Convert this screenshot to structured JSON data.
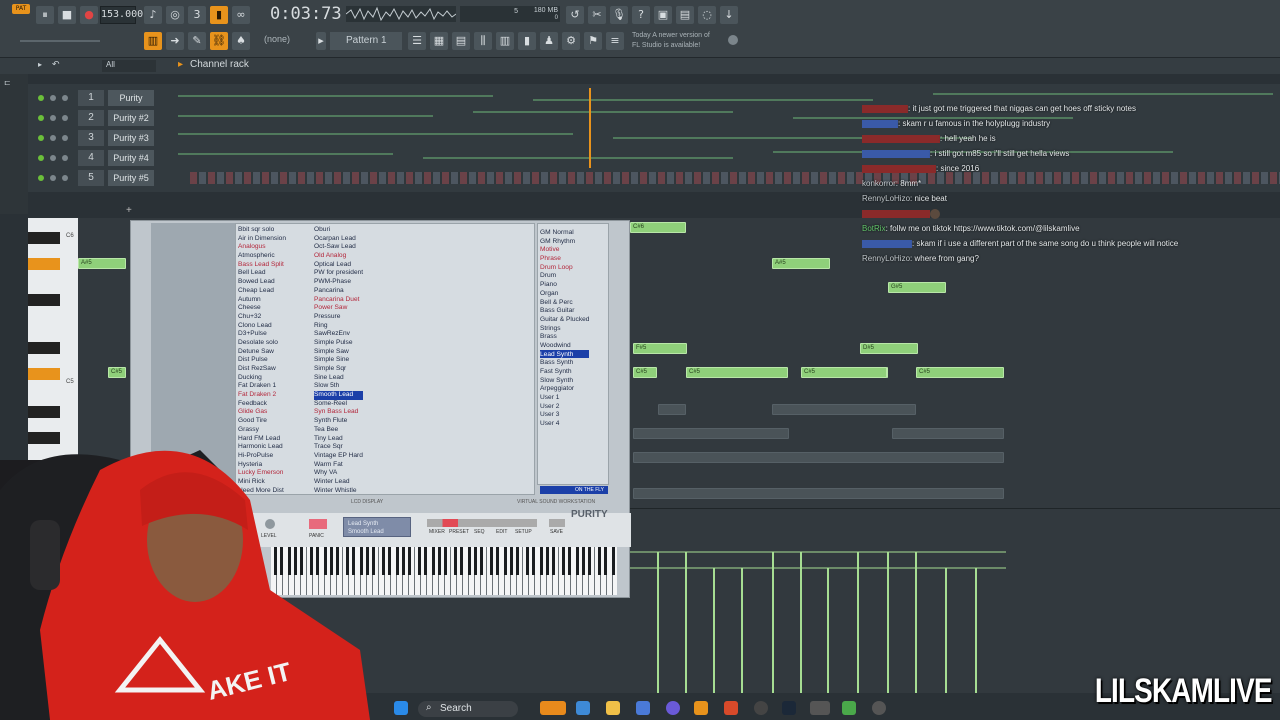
{
  "toolbar": {
    "tempo": "153.000",
    "time": "0:03:73",
    "cpu_value": "5",
    "memory": "180 MB",
    "memory_sub": "0",
    "pattern_label": "Pattern 1",
    "snap": "(none)",
    "news_line1": "Today  A newer version of",
    "news_line2": "FL Studio is available!"
  },
  "channel_rack": {
    "title": "Channel rack",
    "filter": "All",
    "channels": [
      {
        "num": "1",
        "name": "Purity"
      },
      {
        "num": "2",
        "name": "Purity #2"
      },
      {
        "num": "3",
        "name": "Purity #3"
      },
      {
        "num": "4",
        "name": "Purity #4"
      },
      {
        "num": "5",
        "name": "Purity #5"
      }
    ]
  },
  "piano_roll": {
    "key_labels": [
      "C6",
      "C5"
    ],
    "notes": [
      {
        "label": "C#6"
      },
      {
        "label": "A#5"
      },
      {
        "label": "A#5"
      },
      {
        "label": "G#5"
      },
      {
        "label": "F#5"
      },
      {
        "label": "D#5"
      },
      {
        "label": "C#5"
      },
      {
        "label": "C#5"
      },
      {
        "label": "C#5"
      },
      {
        "label": "C#5"
      },
      {
        "label": "A#5"
      },
      {
        "label": "C#5"
      }
    ]
  },
  "plugin": {
    "preset_list_a": [
      "Bbit sqr solo",
      "Air in Dimension",
      "Analogus",
      "Atmospheric",
      "Bass Lead Split",
      "Bell Lead",
      "Bowed Lead",
      "Cheap Lead",
      "Autumn",
      "Cheese",
      "Chu+32",
      "Clono Lead",
      "D3+Pulse",
      "Desolate solo",
      "Detune Saw",
      "Dist Pulse",
      "Dist RezSaw",
      "Ducking",
      "Fat Draken 1",
      "Fat Draken 2",
      "Feedback",
      "Glide Gas",
      "Good Tire",
      "Grassy",
      "Hard FM Lead",
      "Harmonic Lead",
      "Hi-ProPulse",
      "Hysteria",
      "Lucky Emerson",
      "Mini Rick",
      "Need More Dist"
    ],
    "preset_list_b": [
      "Oburi",
      "Ocarpan Lead",
      "Oct-Saw Lead",
      "Old Analog",
      "Optical Lead",
      "PW for president",
      "PWM-Phase",
      "Pancarina",
      "Pancarina Duet",
      "Power Saw",
      "Pressure",
      "Ring",
      "SawRezEnv",
      "Simple Pulse",
      "Simple Saw",
      "Simple Sine",
      "Simple Sqr",
      "Sine Lead",
      "Slow 5th",
      "Smooth Lead",
      "Some-Reel",
      "Syn Bass Lead",
      "Synth Flute",
      "Tea Bee",
      "Tiny Lead",
      "Trace Sqr",
      "Vintage EP Hard",
      "Warm Fat",
      "Why VA",
      "Winter Lead",
      "Winter Whistle"
    ],
    "selected_preset": "Smooth Lead",
    "categories": [
      "GM Normal",
      "GM Rhythm",
      "Motive",
      "Phrase",
      "Drum Loop",
      "Drum",
      "Piano",
      "Organ",
      "Bell & Perc",
      "Bass Guitar",
      "Guitar & Plucked",
      "Strings",
      "Brass",
      "Woodwind",
      "Lead Synth",
      "Bass Synth",
      "Fast Synth",
      "Slow Synth",
      "Arpeggiator",
      "User 1",
      "User 2",
      "User 3",
      "User 4"
    ],
    "selected_category": "Lead Synth",
    "brand": "PURITY",
    "lcd_label": "LCD DISPLAY",
    "vendor": "VIRTUAL  SOUND  WORKSTATION",
    "on_the_fly": "ON THE FLY",
    "display_line1": "Lead Synth",
    "display_line2": "Smooth Lead",
    "knob_labels": [
      "LEVEL",
      "PANIC"
    ],
    "buttons": [
      "MIXER",
      "PRESET",
      "SEQ",
      "EDIT",
      "SETUP",
      "SAVE"
    ]
  },
  "chat": [
    {
      "user": "",
      "text": ": it just got me triggered that niggas can get hoes off sticky notes"
    },
    {
      "user": "",
      "text": ": skam r u famous in the holyplugg industry"
    },
    {
      "user": "",
      "text": ": hell yeah he is"
    },
    {
      "user": "",
      "text": ": i still got m85 so i'll still get hella views"
    },
    {
      "user": "",
      "text": ": since 2016"
    },
    {
      "user": "konkorror",
      "text": ": 8mm*"
    },
    {
      "user": "RennyLoHizo",
      "text": ": nice beat"
    },
    {
      "user": "",
      "text": ""
    },
    {
      "user": "BotRix",
      "text": ": follw me on tiktok https://www.tiktok.com/@lilskamlive"
    },
    {
      "user": "",
      "text": ": skam if i use a different part of the same song do u think people will notice"
    },
    {
      "user": "RennyLoHizo",
      "text": ": where from gang?"
    }
  ],
  "taskbar": {
    "search": "Search"
  },
  "watermark": "LILSKAMLIVE",
  "colors": {
    "accent": "#e8931c",
    "note": "#8fd07a",
    "selection": "#1b3fa8"
  }
}
